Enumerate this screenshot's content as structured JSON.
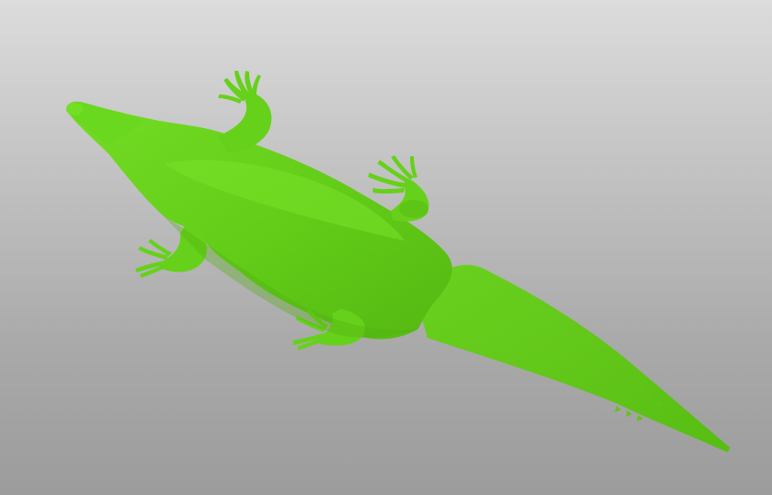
{
  "viewport": {
    "background_top": "#dcdcdc",
    "background_bottom": "#9c9c9c"
  },
  "model": {
    "subject": "crocodile-3d-mesh",
    "view": "top-down",
    "base_color": "#66d11a",
    "highlight_color": "#7fe62c",
    "shadow_color": "#4fae12"
  }
}
